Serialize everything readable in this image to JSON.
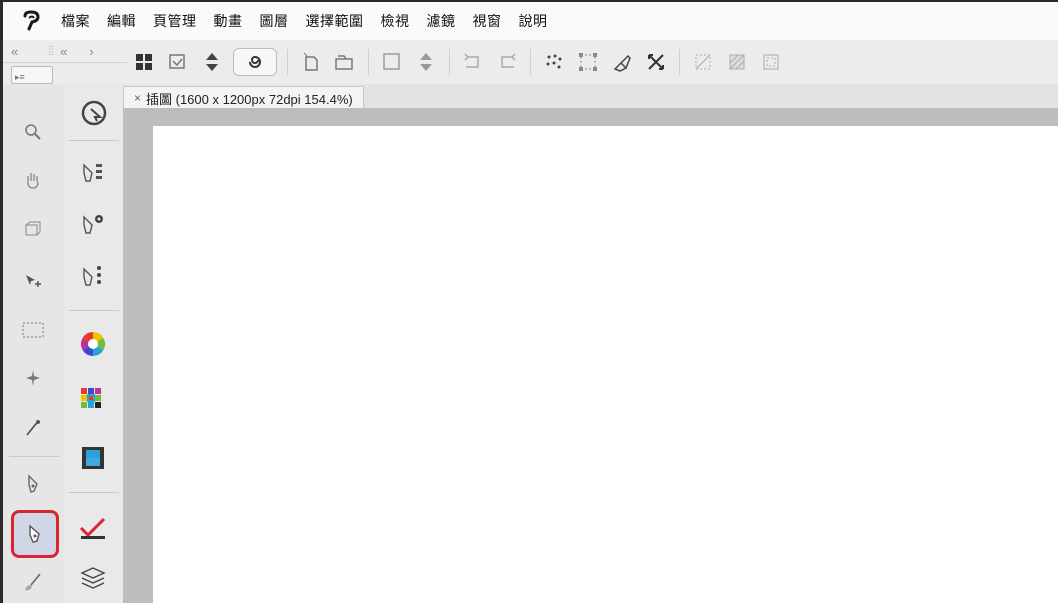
{
  "menubar": {
    "logo": "ᛏ",
    "items": [
      "檔案",
      "編輯",
      "頁管理",
      "動畫",
      "圖層",
      "選擇範圍",
      "檢視",
      "濾鏡",
      "視窗",
      "說明"
    ]
  },
  "document_tab": {
    "close_glyph": "×",
    "title": "插圖 (1600 x 1200px 72dpi 154.4%)"
  },
  "icons": {
    "toolbar": [
      "grid-icon",
      "canvas-icon",
      "arrows-icon",
      "spiral-icon",
      "new-file-icon",
      "open-icon",
      "blank-icon",
      "up-down-icon",
      "undo-icon",
      "redo-icon",
      "scatter-icon",
      "transform-icon",
      "brush-icon",
      "crop-icon",
      "deselect-icon",
      "pattern-icon",
      "frame-icon"
    ],
    "left1": [
      "magnifier-icon",
      "hand-icon",
      "box-select-icon",
      "move-icon",
      "rect-select-icon",
      "magic-wand-icon",
      "eyedropper-icon",
      "pen-icon",
      "pencil-icon",
      "brush-icon"
    ],
    "left2": [
      "cursor-icon",
      "layer-props-icon",
      "sub-tool-icon",
      "sub-tool-detail-icon",
      "color-wheel-icon",
      "color-set-icon",
      "animation-icon",
      "check-icon",
      "layers-icon"
    ]
  },
  "colors": {
    "selection_border": "#d7262e",
    "selection_fill": "#cfd6e6"
  }
}
